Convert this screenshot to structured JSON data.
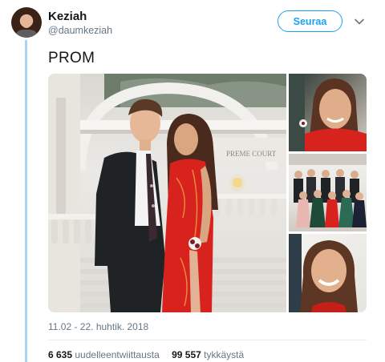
{
  "tweet": {
    "author_name": "Keziah",
    "author_handle": "@daumkeziah",
    "follow_label": "Seuraa",
    "text": "PROM",
    "timestamp": "11.02 - 22. huhtik. 2018",
    "stats": {
      "retweets_count": "6 635",
      "retweets_label": "uudelleentwiittausta",
      "likes_count": "99 557",
      "likes_label": "tykkäystä"
    },
    "media_count": 4,
    "sign_text": "PREME COURT"
  },
  "colors": {
    "accent": "#1da1f2",
    "thread_line": "#a6d4f2",
    "text_primary": "#14171a",
    "text_secondary": "#657786",
    "red_dress": "#d8221d"
  },
  "icons": {
    "menu": "chevron-down-icon"
  }
}
